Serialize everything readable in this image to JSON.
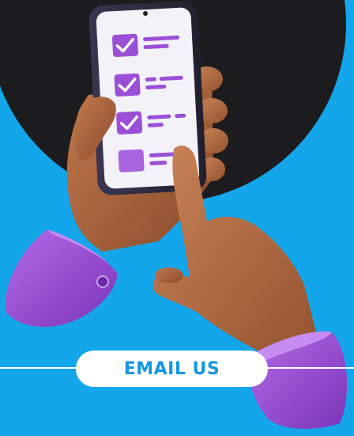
{
  "cta": {
    "label": "EMAIL US"
  },
  "colors": {
    "background": "#14a6ea",
    "dark_circle": "#1c1c1e",
    "accent_purple": "#9b4fd6",
    "button_text": "#1597e2",
    "button_bg": "#ffffff"
  },
  "checklist": {
    "items": [
      {
        "state": "checked"
      },
      {
        "state": "checked"
      },
      {
        "state": "checked"
      },
      {
        "state": "unchecked"
      }
    ]
  },
  "icons": [
    "checkbox-checked-icon",
    "checkbox-empty-icon",
    "cuff-button-icon",
    "camera-icon"
  ]
}
